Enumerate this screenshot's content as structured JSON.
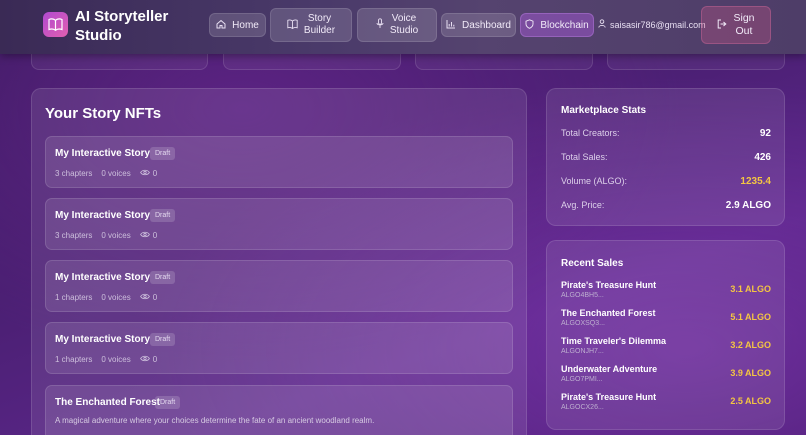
{
  "header": {
    "brand_line1": "AI Storyteller",
    "brand_line2": "Studio",
    "nav": {
      "home": "Home",
      "story_builder_1": "Story",
      "story_builder_2": "Builder",
      "voice_studio_1": "Voice",
      "voice_studio_2": "Studio",
      "dashboard": "Dashboard",
      "blockchain": "Blockchain"
    },
    "user_email": "saisasir786@gmail.com",
    "signout_1": "Sign",
    "signout_2": "Out"
  },
  "nfts": {
    "title": "Your Story NFTs",
    "stories": [
      {
        "title": "My Interactive Story",
        "status": "Draft",
        "chapters": "3 chapters",
        "voices": "0 voices",
        "views": "0"
      },
      {
        "title": "My Interactive Story",
        "status": "Draft",
        "chapters": "3 chapters",
        "voices": "0 voices",
        "views": "0"
      },
      {
        "title": "My Interactive Story",
        "status": "Draft",
        "chapters": "1 chapters",
        "voices": "0 voices",
        "views": "0"
      },
      {
        "title": "My Interactive Story",
        "status": "Draft",
        "chapters": "1 chapters",
        "voices": "0 voices",
        "views": "0"
      },
      {
        "title": "The Enchanted Forest",
        "status": "Draft",
        "description": "A magical adventure where your choices determine the fate of an ancient woodland realm."
      }
    ]
  },
  "marketplace": {
    "title": "Marketplace Stats",
    "stats": [
      {
        "label": "Total Creators:",
        "value": "92"
      },
      {
        "label": "Total Sales:",
        "value": "426"
      },
      {
        "label": "Volume (ALGO):",
        "value": "1235.4"
      },
      {
        "label": "Avg. Price:",
        "value": "2.9 ALGO"
      }
    ]
  },
  "recent_sales": {
    "title": "Recent Sales",
    "items": [
      {
        "title": "Pirate's Treasure Hunt",
        "id": "ALGO4BH5...",
        "price": "3.1 ALGO"
      },
      {
        "title": "The Enchanted Forest",
        "id": "ALGOXSQ3...",
        "price": "5.1 ALGO"
      },
      {
        "title": "Time Traveler's Dilemma",
        "id": "ALGONJH7...",
        "price": "3.2 ALGO"
      },
      {
        "title": "Underwater Adventure",
        "id": "ALGO7PMI...",
        "price": "3.9 ALGO"
      },
      {
        "title": "Pirate's Treasure Hunt",
        "id": "ALGOCX26...",
        "price": "2.5 ALGO"
      }
    ]
  },
  "colors": {
    "accent_gold": "#f4c542",
    "logo_gradient_start": "#b04ad0",
    "logo_gradient_end": "#e25fb0"
  },
  "icons": [
    "book-icon",
    "home-icon",
    "book-open-icon",
    "mic-icon",
    "bar-chart-icon",
    "shield-icon",
    "user-icon",
    "logout-icon",
    "eye-icon"
  ]
}
